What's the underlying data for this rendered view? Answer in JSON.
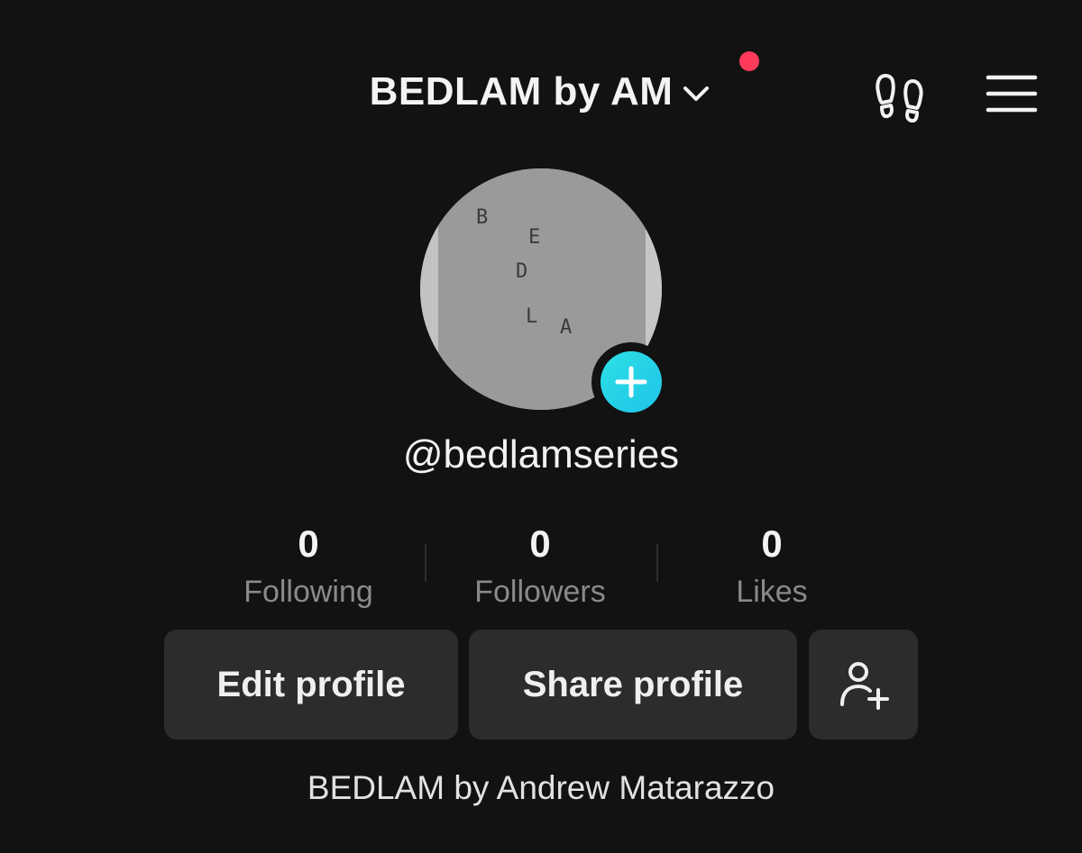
{
  "header": {
    "account_name": "BEDLAM by AM",
    "chevron_icon": "chevron-down-icon",
    "notification_dot_color": "#ff3b5c",
    "footprints_icon": "footprints-icon",
    "menu_icon": "hamburger-menu-icon"
  },
  "profile": {
    "avatar_letters": [
      "B",
      "E",
      "D",
      "L",
      "A"
    ],
    "add_photo_icon": "plus-icon",
    "add_photo_color": "#20d5ec",
    "username": "@bedlamseries"
  },
  "stats": [
    {
      "value": "0",
      "label": "Following"
    },
    {
      "value": "0",
      "label": "Followers"
    },
    {
      "value": "0",
      "label": "Likes"
    }
  ],
  "actions": {
    "edit_profile": "Edit profile",
    "share_profile": "Share profile",
    "add_friend_icon": "add-user-icon"
  },
  "bio": "BEDLAM by Andrew Matarazzo"
}
